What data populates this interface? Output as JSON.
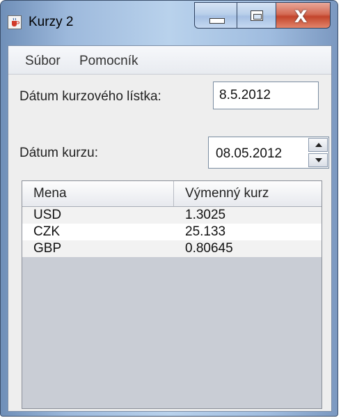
{
  "window": {
    "title": "Kurzy 2",
    "icon": "java-cup-icon"
  },
  "titlebar_buttons": {
    "minimize": "minimize-icon",
    "maximize": "maximize-icon",
    "close": "close-icon",
    "close_glyph": "X"
  },
  "menu": {
    "items": [
      {
        "label": "Súbor"
      },
      {
        "label": "Pomocník"
      }
    ]
  },
  "form": {
    "list_date_label": "Dátum kurzového lístka:",
    "list_date_value": "8.5.2012",
    "rate_date_label": "Dátum kurzu:",
    "rate_date_value": "08.05.2012"
  },
  "table": {
    "columns": [
      "Mena",
      "Výmenný kurz"
    ],
    "rows": [
      {
        "currency": "USD",
        "rate": "1.3025"
      },
      {
        "currency": "CZK",
        "rate": "25.133"
      },
      {
        "currency": "GBP",
        "rate": "0.80645"
      }
    ]
  },
  "colors": {
    "close_button": "#c3452c",
    "table_empty_area": "#c9cdd5"
  }
}
